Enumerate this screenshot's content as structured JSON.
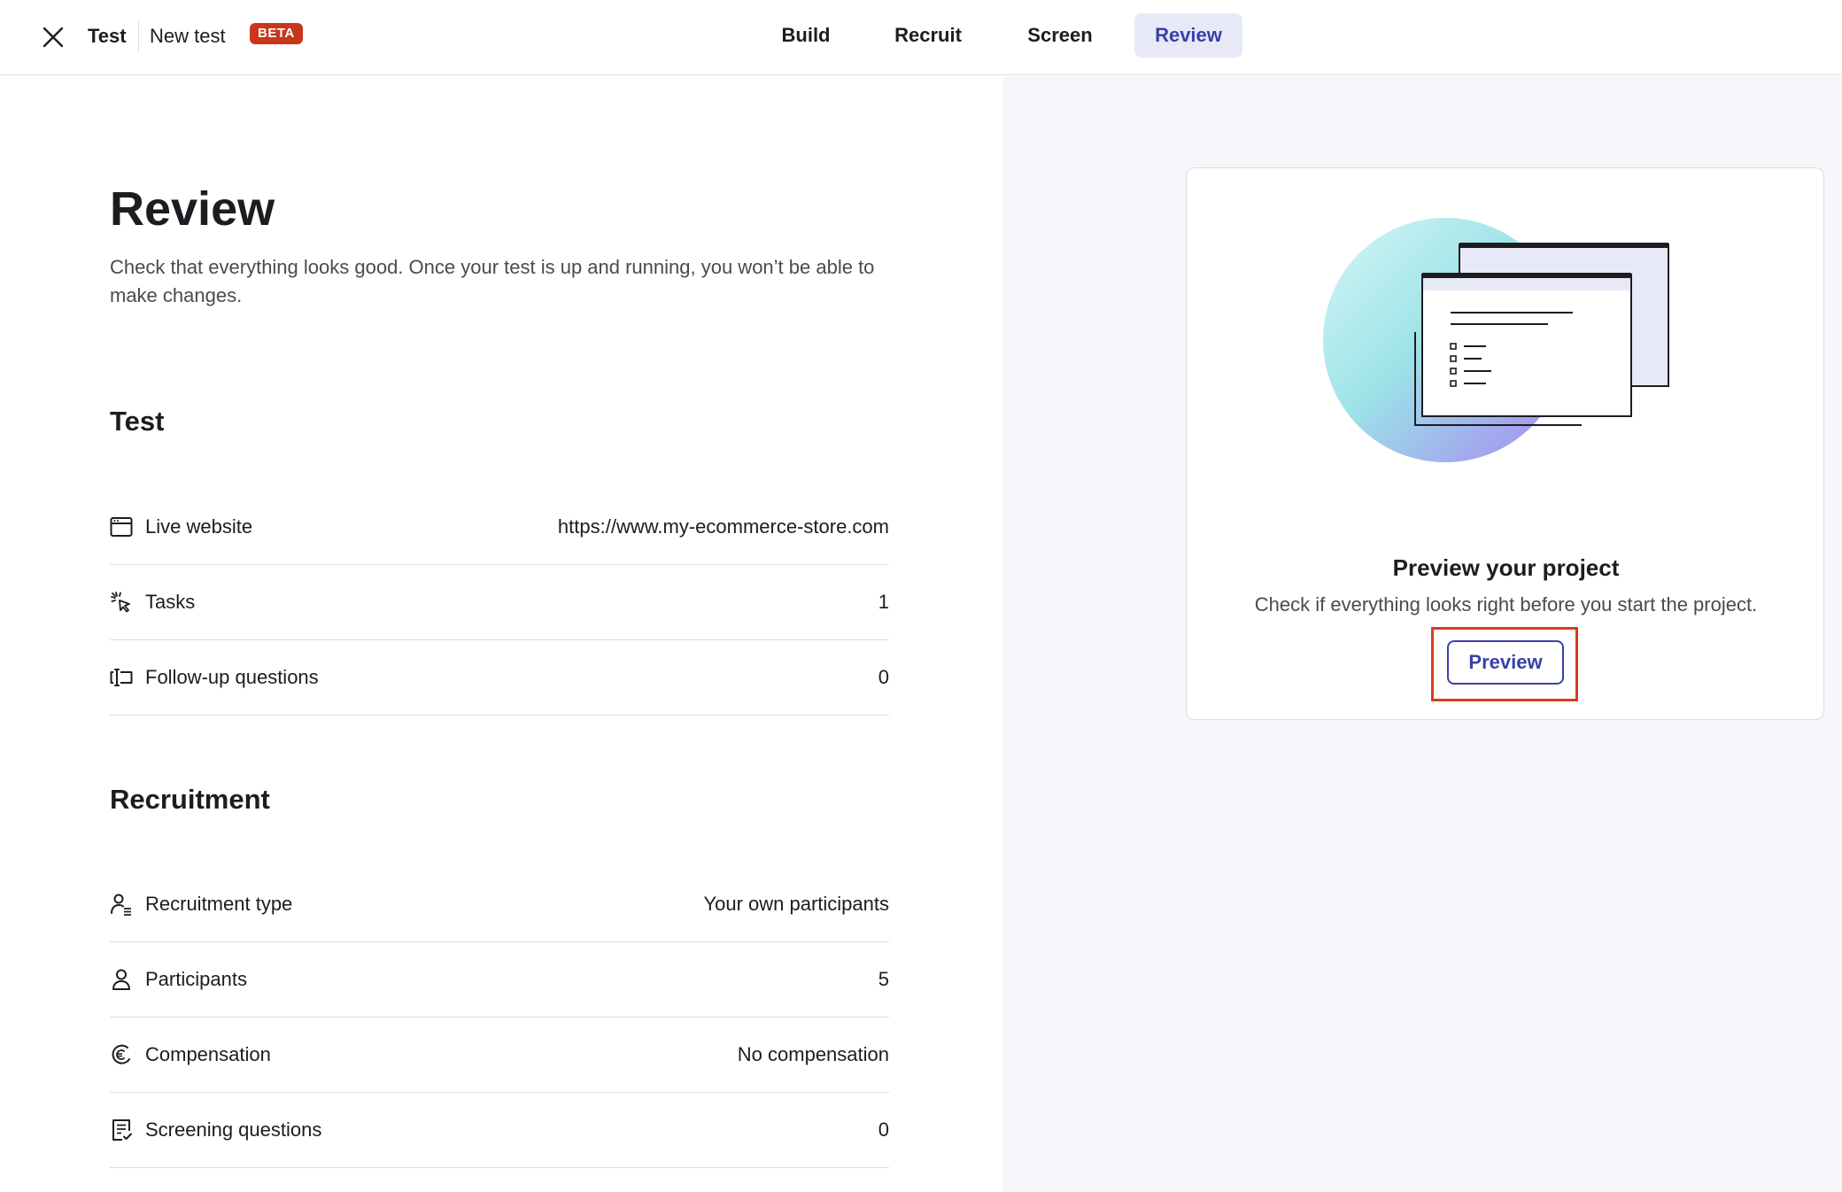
{
  "header": {
    "close_icon": "close-icon",
    "project_name": "Test",
    "test_name": "New test",
    "badge": "BETA",
    "badge_color": "#c9361c",
    "tabs": [
      {
        "label": "Build",
        "active": false
      },
      {
        "label": "Recruit",
        "active": false
      },
      {
        "label": "Screen",
        "active": false
      },
      {
        "label": "Review",
        "active": true
      }
    ],
    "accent_color": "#3a3fa8"
  },
  "main": {
    "title": "Review",
    "description": "Check that everything looks good. Once your test is up and running, you won’t be able to make changes.",
    "test_section": {
      "title": "Test",
      "rows": [
        {
          "icon": "browser-window-icon",
          "label": "Live website",
          "value": "https://www.my-ecommerce-store.com"
        },
        {
          "icon": "cursor-click-icon",
          "label": "Tasks",
          "value": "1"
        },
        {
          "icon": "text-input-icon",
          "label": "Follow-up questions",
          "value": "0"
        }
      ]
    },
    "recruitment_section": {
      "title": "Recruitment",
      "rows": [
        {
          "icon": "user-list-icon",
          "label": "Recruitment type",
          "value": "Your own participants"
        },
        {
          "icon": "user-icon",
          "label": "Participants",
          "value": "5"
        },
        {
          "icon": "euro-coin-icon",
          "label": "Compensation",
          "value": "No compensation"
        },
        {
          "icon": "checklist-icon",
          "label": "Screening questions",
          "value": "0"
        }
      ]
    }
  },
  "preview_card": {
    "illustration": "preview-windows-illustration",
    "title": "Preview your project",
    "description": "Check if everything looks right before you start the project.",
    "button_label": "Preview",
    "highlight_color": "#d93c1c"
  }
}
